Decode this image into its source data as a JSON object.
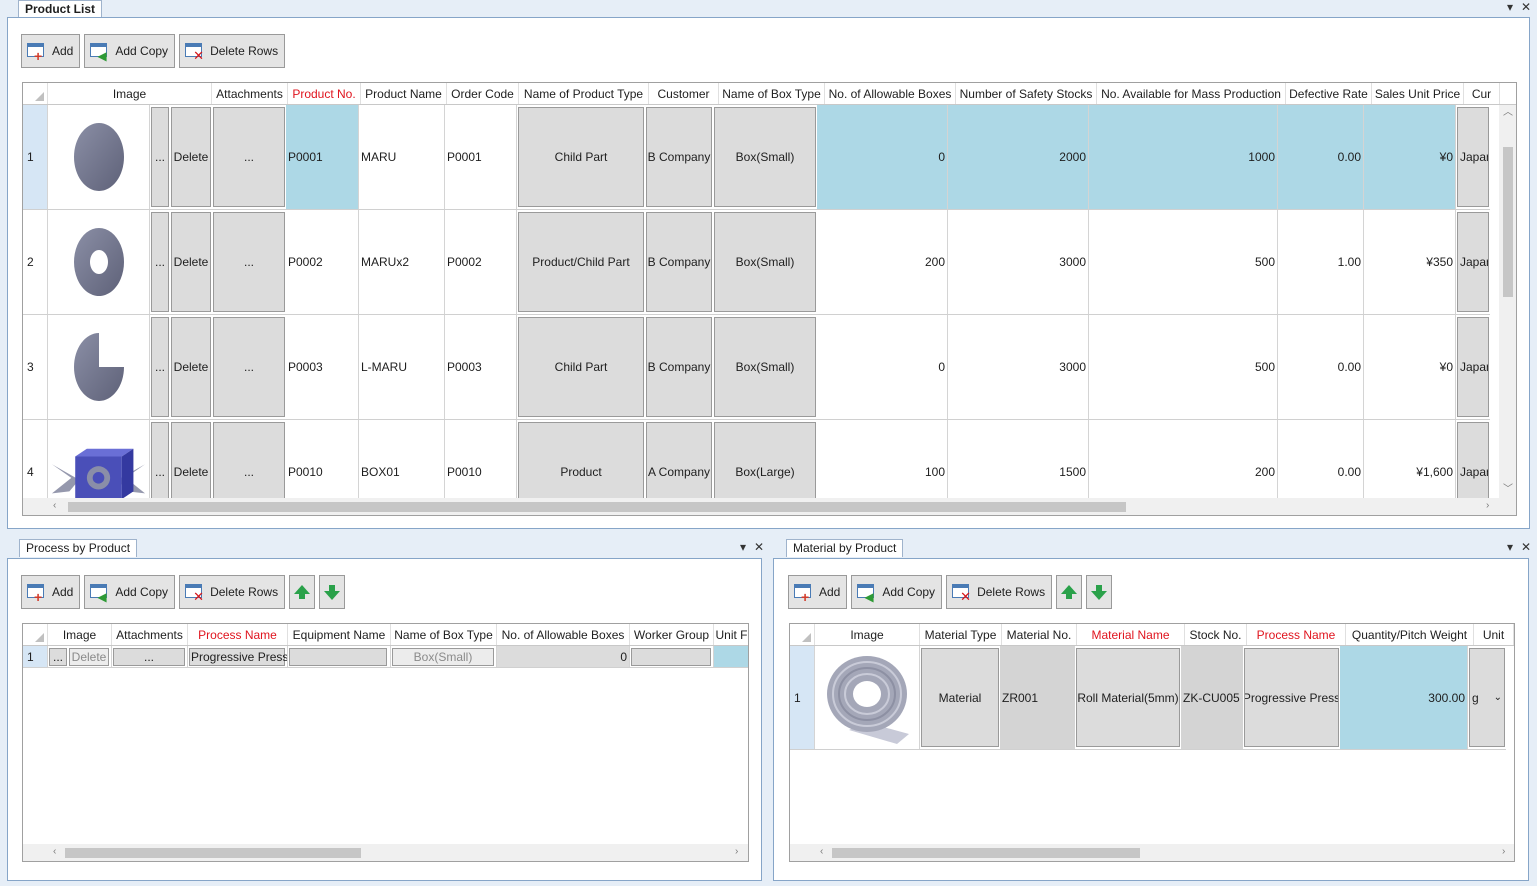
{
  "product_list": {
    "title": "Product List",
    "controls": {
      "menu": "▾",
      "close": "✕"
    },
    "toolbar": {
      "add": "Add",
      "add_copy": "Add Copy",
      "delete_rows": "Delete Rows"
    },
    "columns": [
      "Image",
      "Attachments",
      "Product No.",
      "Product Name",
      "Order Code",
      "Name of Product Type",
      "Customer",
      "Name of Box Type",
      "No. of Allowable Boxes",
      "Number of Safety Stocks",
      "No. Available for Mass Production",
      "Defective Rate",
      "Sales Unit Price",
      "Cur"
    ],
    "image_buttons": {
      "browse": "...",
      "delete": "Delete"
    },
    "rows": [
      {
        "n": "1",
        "shape": "disc",
        "attach": "...",
        "product_no": "P0001",
        "product_name": "MARU",
        "order_code": "P0001",
        "type": "Child Part",
        "customer": "B Company",
        "box": "Box(Small)",
        "allow": "0",
        "safety": "2000",
        "mass": "1000",
        "defect": "0.00",
        "price": "¥0",
        "cur": "Japan"
      },
      {
        "n": "2",
        "shape": "ring",
        "attach": "...",
        "product_no": "P0002",
        "product_name": "MARUx2",
        "order_code": "P0002",
        "type": "Product/Child Part",
        "customer": "B Company",
        "box": "Box(Small)",
        "allow": "200",
        "safety": "3000",
        "mass": "500",
        "defect": "1.00",
        "price": "¥350",
        "cur": "Japan"
      },
      {
        "n": "3",
        "shape": "cut-disc",
        "attach": "...",
        "product_no": "P0003",
        "product_name": "L-MARU",
        "order_code": "P0003",
        "type": "Child Part",
        "customer": "B Company",
        "box": "Box(Small)",
        "allow": "0",
        "safety": "3000",
        "mass": "500",
        "defect": "0.00",
        "price": "¥0",
        "cur": "Japan"
      },
      {
        "n": "4",
        "shape": "box",
        "attach": "...",
        "product_no": "P0010",
        "product_name": "BOX01",
        "order_code": "P0010",
        "type": "Product",
        "customer": "A Company",
        "box": "Box(Large)",
        "allow": "100",
        "safety": "1500",
        "mass": "200",
        "defect": "0.00",
        "price": "¥1,600",
        "cur": "Japan"
      }
    ]
  },
  "process_by_product": {
    "title": "Process by Product",
    "controls": {
      "menu": "▾",
      "close": "✕"
    },
    "toolbar": {
      "add": "Add",
      "add_copy": "Add Copy",
      "delete_rows": "Delete Rows"
    },
    "columns": [
      "Image",
      "Attachments",
      "Process Name",
      "Equipment Name",
      "Name of Box Type",
      "No. of Allowable Boxes",
      "Worker Group",
      "Unit F"
    ],
    "rows": [
      {
        "n": "1",
        "browse": "...",
        "delete": "Delete",
        "attach": "...",
        "process": "Progressive Press",
        "equipment": "",
        "box": "Box(Small)",
        "allow": "0",
        "worker": "",
        "unit": ""
      }
    ]
  },
  "material_by_product": {
    "title": "Material by Product",
    "controls": {
      "menu": "▾",
      "close": "✕"
    },
    "toolbar": {
      "add": "Add",
      "add_copy": "Add Copy",
      "delete_rows": "Delete Rows"
    },
    "columns": [
      "Image",
      "Material Type",
      "Material No.",
      "Material Name",
      "Stock No.",
      "Process Name",
      "Quantity/Pitch Weight",
      "Unit"
    ],
    "rows": [
      {
        "n": "1",
        "shape": "roll",
        "type": "Material",
        "material_no": "ZR001",
        "material_name": "Roll Material(5mm)",
        "stock_no": "ZK-CU005",
        "process": "Progressive Press",
        "qty": "300.00",
        "unit": "g"
      }
    ]
  }
}
